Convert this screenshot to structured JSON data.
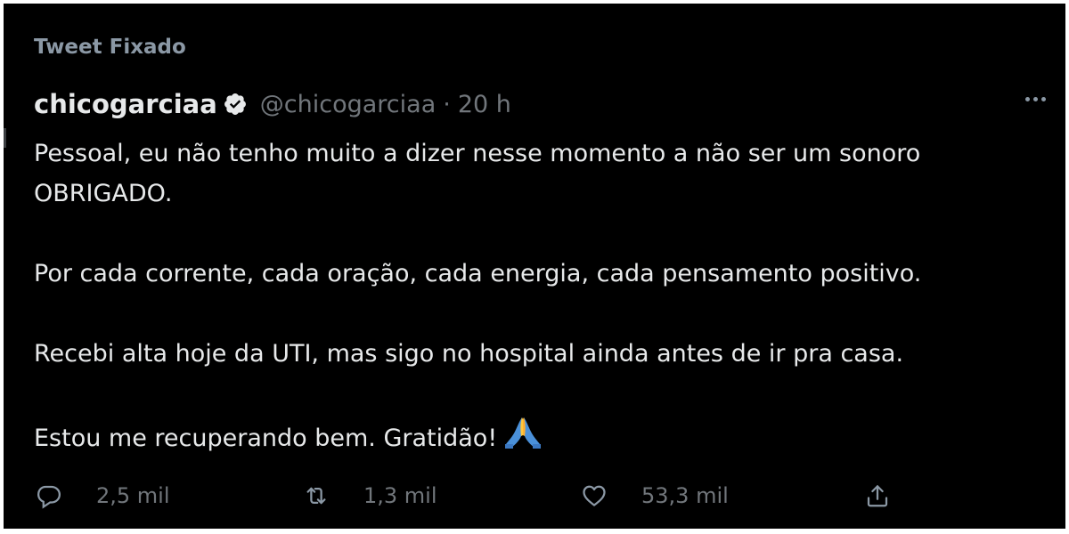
{
  "pinned": {
    "label": "Tweet Fixado"
  },
  "author": {
    "display_name": "chicogarciaa",
    "handle": "@chicogarciaa",
    "separator": "·",
    "time": "20 h"
  },
  "tweet": {
    "paragraphs": [
      {
        "lines": [
          "Pessoal, eu não tenho muito a dizer nesse momento a não ser um sonoro",
          "OBRIGADO."
        ]
      },
      {
        "lines": [
          "Por cada corrente, cada oração, cada energia, cada pensamento positivo."
        ]
      },
      {
        "lines": [
          "Recebi alta hoje da UTI, mas sigo no hospital ainda antes de ir pra casa."
        ]
      },
      {
        "lines": [
          "Estou me recuperando bem. Gratidão!"
        ]
      }
    ],
    "emoji_icon": "folded-hands-emoji"
  },
  "actions": {
    "reply": {
      "icon": "reply-icon",
      "count": "2,5 mil"
    },
    "retweet": {
      "icon": "retweet-icon",
      "count": "1,3 mil"
    },
    "like": {
      "icon": "heart-icon",
      "count": "53,3 mil"
    },
    "share": {
      "icon": "share-icon"
    }
  },
  "colors": {
    "background": "#000000",
    "text": "#e7e9ea",
    "muted": "#71767b",
    "verified": "#e7e9ea"
  }
}
